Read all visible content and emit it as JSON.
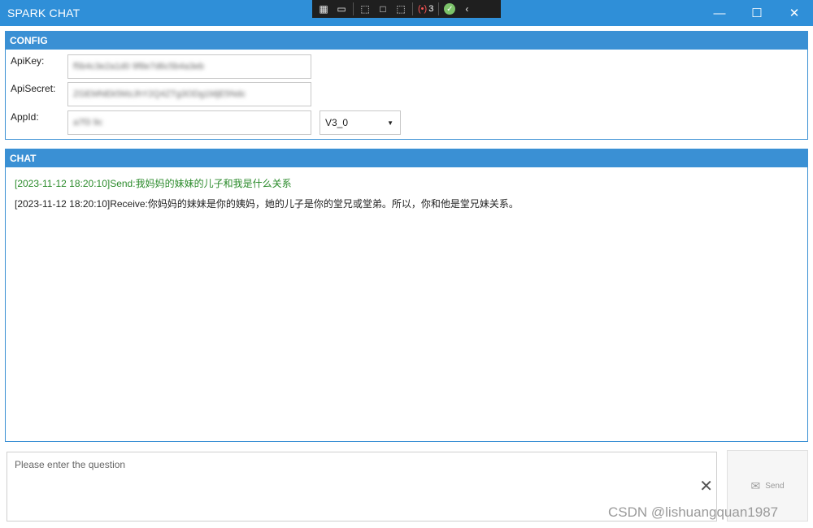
{
  "window": {
    "title": "SPARK CHAT"
  },
  "devtools": {
    "badge_count": "3"
  },
  "config": {
    "header": "CONFIG",
    "fields": [
      {
        "label": "ApiKey:",
        "value": "f5b4c3e2a1d0 9f8e7d6c5b4a3eb"
      },
      {
        "label": "ApiSecret:",
        "value": "ZGEMNEk5MzJhY2Q4ZTg3ODg1MjE5Ndc"
      },
      {
        "label": "AppId:",
        "value": "a7f3 9c"
      }
    ],
    "version": "V3_0"
  },
  "chat": {
    "header": "CHAT",
    "messages": [
      {
        "type": "send",
        "text": "[2023-11-12 18:20:10]Send:我妈妈的妹妹的儿子和我是什么关系"
      },
      {
        "type": "receive",
        "text": "[2023-11-12 18:20:10]Receive:你妈妈的妹妹是你的姨妈，她的儿子是你的堂兄或堂弟。所以，你和他是堂兄妹关系。"
      }
    ]
  },
  "input": {
    "placeholder": "Please enter the question"
  },
  "send_button": {
    "label": "Send"
  },
  "watermark": "CSDN @lishuangquan1987",
  "colors": {
    "accent": "#2f8fd8",
    "panel_border": "#3a90d4",
    "sent_text": "#2a8a2a"
  }
}
